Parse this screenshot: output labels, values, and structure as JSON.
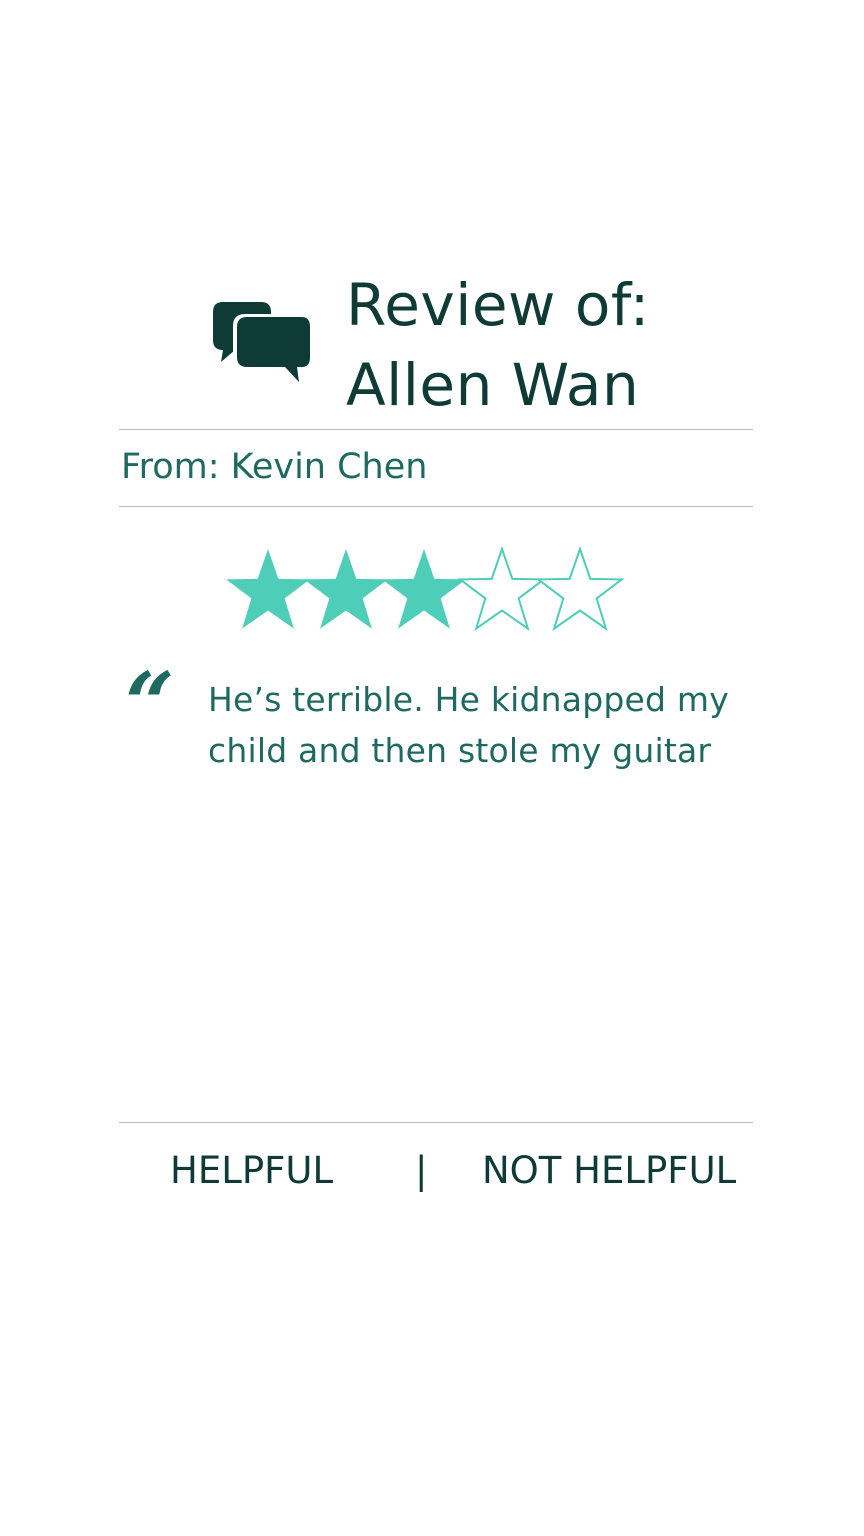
{
  "header": {
    "icon": "chat-bubbles-icon",
    "title_line1": "Review of:",
    "title_line2": "Allen Wan"
  },
  "review": {
    "from": "From: Kevin Chen",
    "rating": 3,
    "rating_max": 5,
    "quote": "He’s terrible. He kidnapped my child and then stole my guitar",
    "quote_icon": "quote-mark-icon"
  },
  "actions": {
    "helpful_label": "HELPFUL",
    "divider": "|",
    "not_helpful_label": "NOT HELPFUL"
  },
  "colors": {
    "dark": "#0e3b36",
    "text": "#1e6a60",
    "star": "#4ecdb8",
    "rule": "#bdbdbd"
  }
}
